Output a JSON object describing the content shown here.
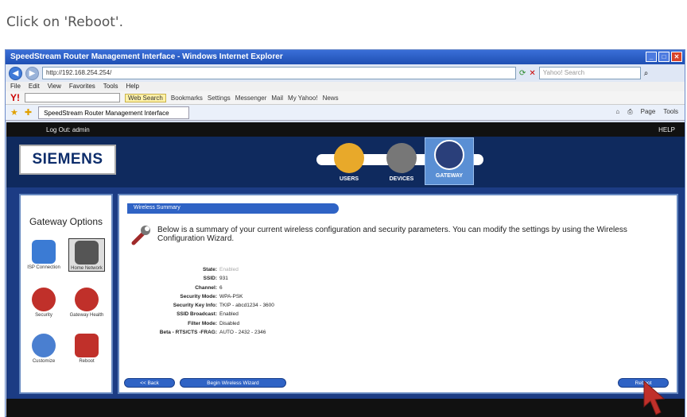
{
  "instruction": "Click on 'Reboot'.",
  "browser": {
    "title": "SpeedStream Router Management Interface - Windows Internet Explorer",
    "url": "http://192.168.254.254/",
    "search_placeholder": "Yahoo! Search",
    "menu": [
      "File",
      "Edit",
      "View",
      "Favorites",
      "Tools",
      "Help"
    ],
    "yahoo_toolbar": [
      "Web Search",
      "Bookmarks",
      "Settings",
      "Messenger",
      "Mail",
      "My Yahoo!",
      "News"
    ],
    "tab_title": "SpeedStream Router Management Interface",
    "tab_tools": [
      "Page",
      "Tools"
    ]
  },
  "router": {
    "logout_label": "Log Out: admin",
    "help_label": "HELP",
    "brand": "SIEMENS",
    "topnav": [
      {
        "label": "USERS",
        "color": "#e8a92a"
      },
      {
        "label": "DEVICES",
        "color": "#777777"
      },
      {
        "label": "GATEWAY",
        "color": "#2a3f7a"
      }
    ],
    "sidebar_title": "Gateway Options",
    "options": [
      {
        "label": "ISP Connection",
        "color": "#3b7bd4"
      },
      {
        "label": "Home Network",
        "color": "#555555"
      },
      {
        "label": "Security",
        "color": "#c0302a"
      },
      {
        "label": "Gateway Health",
        "color": "#c0302a"
      },
      {
        "label": "Customize",
        "color": "#4a7fd0"
      },
      {
        "label": "Reboot",
        "color": "#c0302a"
      }
    ],
    "section_title": "Wireless Summary",
    "summary_text": "Below is a summary of your current wireless configuration and security parameters. You can modify the settings by using the Wireless Configuration Wizard.",
    "fields": [
      {
        "key": "State:",
        "value": "Enabled"
      },
      {
        "key": "SSID:",
        "value": "931"
      },
      {
        "key": "Channel:",
        "value": "6"
      },
      {
        "key": "Security Mode:",
        "value": "WPA-PSK"
      },
      {
        "key": "Security Key Info:",
        "value": "TKIP - abcd1234 - 3600"
      },
      {
        "key": "SSID Broadcast:",
        "value": "Enabled"
      },
      {
        "key": "Filter Mode:",
        "value": "Disabled"
      },
      {
        "key": "Beta - RTS/CTS -FRAG:",
        "value": "AUTO - 2432 - 2346"
      }
    ],
    "buttons": {
      "back": "<< Back",
      "wizard": "Begin Wireless Wizard",
      "reboot": "Reboot"
    }
  }
}
